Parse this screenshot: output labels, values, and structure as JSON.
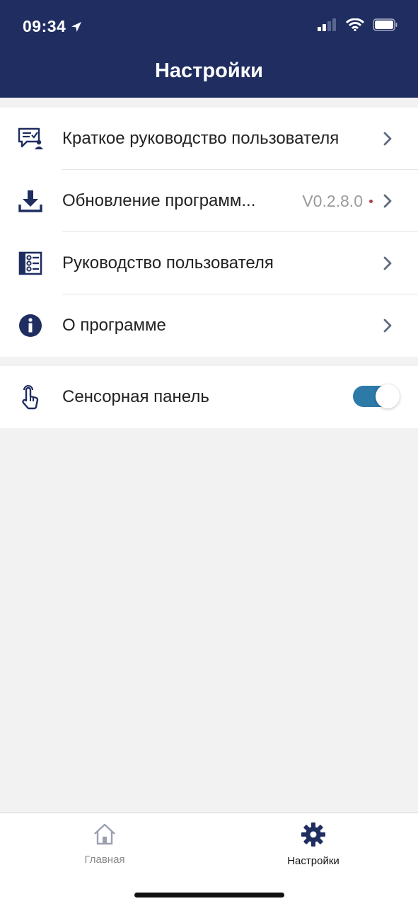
{
  "status": {
    "time": "09:34"
  },
  "header": {
    "title": "Настройки"
  },
  "settings": {
    "items": [
      {
        "label": "Краткое руководство пользователя",
        "icon": "chat-user-icon"
      },
      {
        "label": "Обновление программ...",
        "icon": "download-icon",
        "version": "V0.2.8.0"
      },
      {
        "label": "Руководство пользователя",
        "icon": "list-icon"
      },
      {
        "label": "О программе",
        "icon": "info-icon"
      }
    ],
    "touch": {
      "label": "Сенсорная панель",
      "icon": "touch-hand-icon",
      "enabled": true
    }
  },
  "tabbar": {
    "home_label": "Главная",
    "settings_label": "Настройки"
  },
  "colors": {
    "header": "#1f2d61",
    "accent": "#2d79a8",
    "icon": "#1f2d61"
  }
}
